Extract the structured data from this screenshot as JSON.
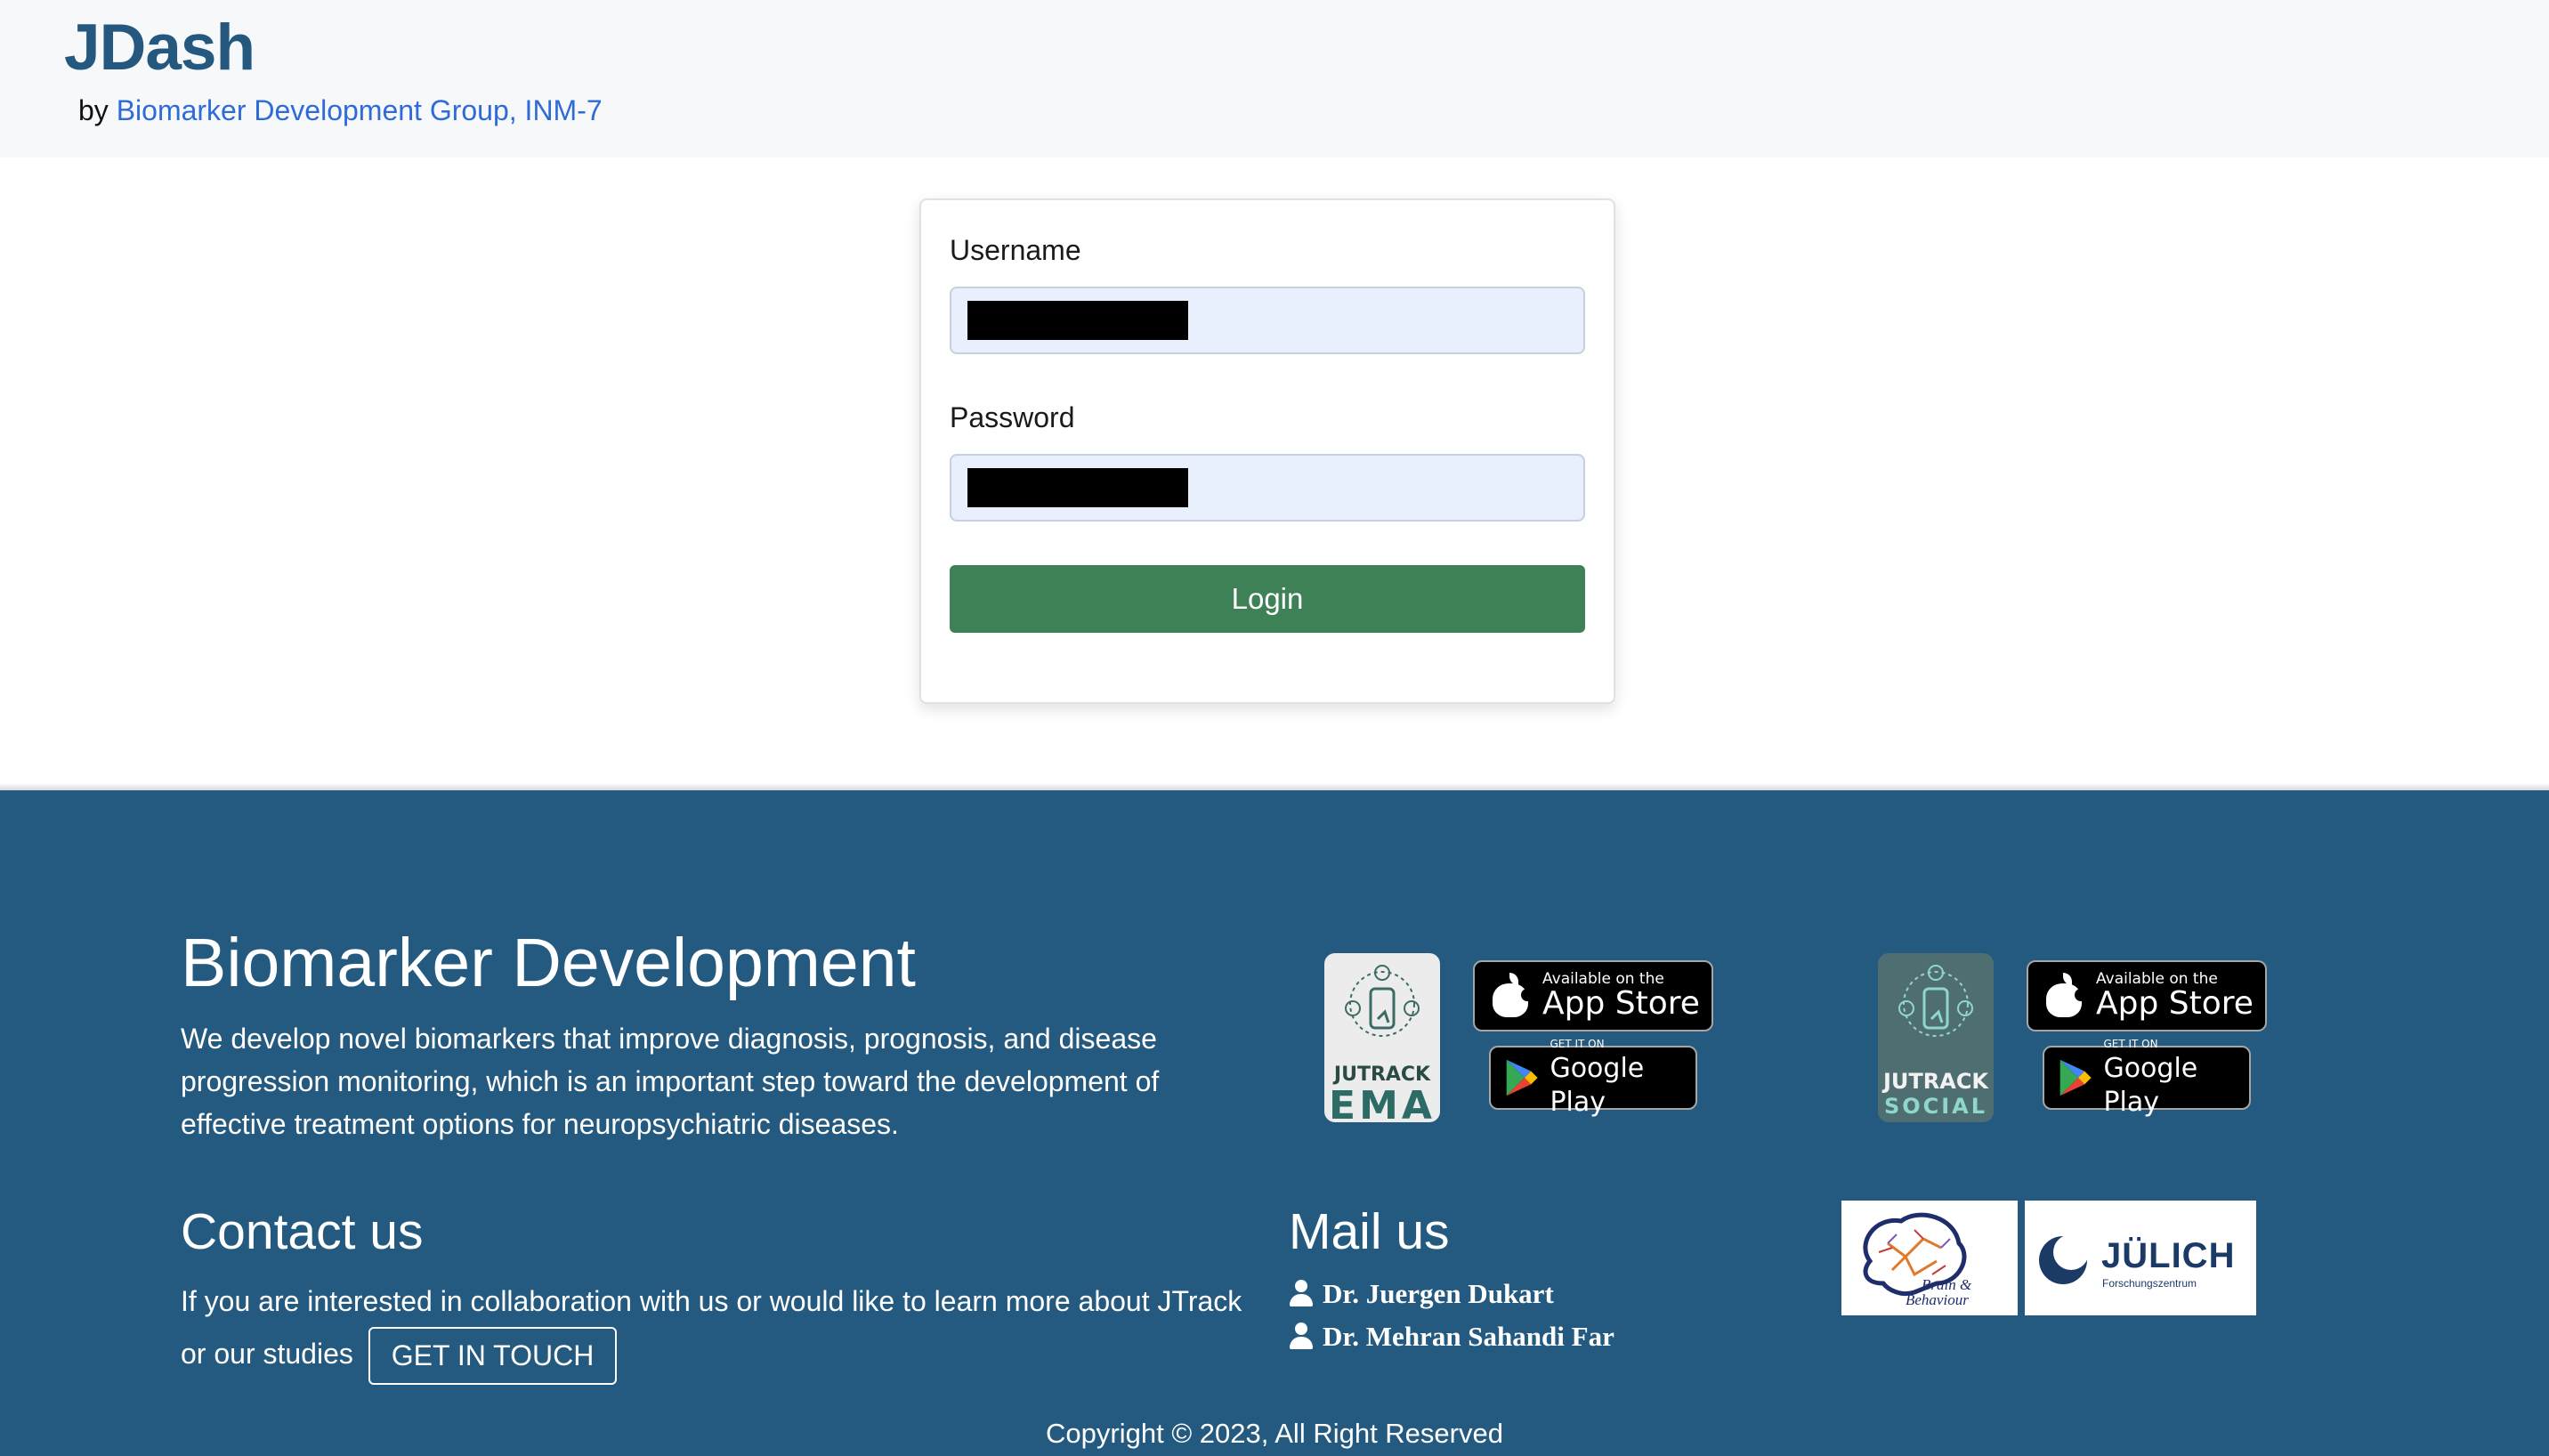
{
  "header": {
    "title": "JDash",
    "by_prefix": "by",
    "org_link": "Biomarker Development Group, INM-7"
  },
  "login": {
    "username_label": "Username",
    "password_label": "Password",
    "username_value": "",
    "password_value": "",
    "login_label": "Login"
  },
  "footer": {
    "title": "Biomarker Development",
    "description": "We develop novel biomarkers that improve diagnosis, prognosis, and disease progression monitoring, which is an important step toward the development of effective treatment options for neuropsychiatric diseases.",
    "contact_title": "Contact us",
    "contact_text": "If you are interested in collaboration with us or would like to learn more about JTrack or our studies",
    "get_in_touch_label": "GET IN TOUCH",
    "mail_title": "Mail us",
    "contacts": [
      "Dr. Juergen Dukart",
      "Dr. Mehran Sahandi Far"
    ],
    "copyright": "Copyright © 2023, All Right Reserved"
  },
  "apps": [
    {
      "name_line1": "JUTRACK",
      "name_line2": "EMA"
    },
    {
      "name_line1": "JUTRACK",
      "name_line2": "SOCIAL"
    }
  ],
  "badges": {
    "appstore_small": "Available on the",
    "appstore_big": "App Store",
    "googleplay_small": "GET IT ON",
    "googleplay_big": "Google Play"
  },
  "logos": {
    "brain_caption_1": "Brain &",
    "brain_caption_2": "Behaviour",
    "julich_name": "JÜLICH",
    "julich_sub": "Forschungszentrum"
  },
  "colors": {
    "brand": "#24587f",
    "link": "#2f6bd8",
    "login_button": "#3f8156",
    "input_fill": "#e8f0fe",
    "footer_bg": "#245a80"
  }
}
